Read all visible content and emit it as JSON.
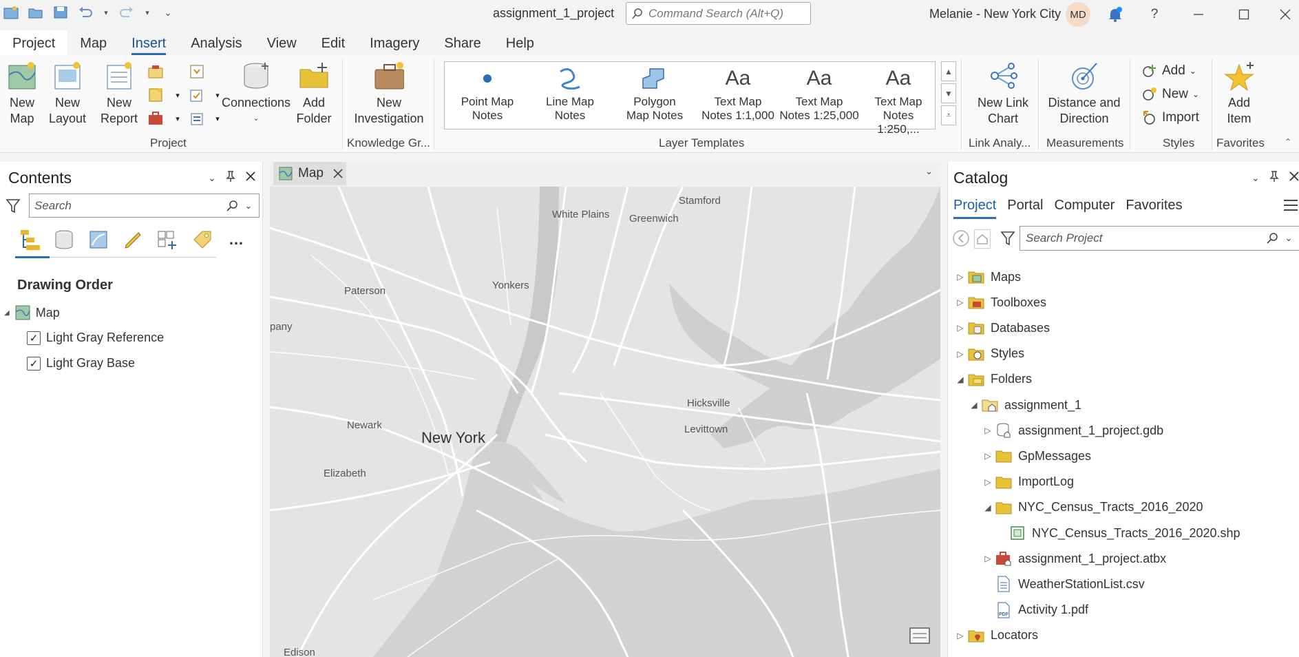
{
  "window": {
    "title": "assignment_1_project",
    "command_search_placeholder": "Command Search (Alt+Q)",
    "user": "Melanie - New York City",
    "avatar_initials": "MD"
  },
  "menu": {
    "tabs": [
      "Project",
      "Map",
      "Insert",
      "Analysis",
      "View",
      "Edit",
      "Imagery",
      "Share",
      "Help"
    ],
    "active": "Insert"
  },
  "ribbon": {
    "project_group": {
      "label": "Project",
      "new_map": "New Map",
      "new_layout": "New Layout",
      "new_report": "New Report",
      "connections": "Connections",
      "add_folder": "Add Folder"
    },
    "knowledge_group": {
      "label": "Knowledge Gr...",
      "new_investigation": "New Investigation"
    },
    "layer_templates": {
      "label": "Layer Templates",
      "items": [
        {
          "line1": "Point Map",
          "line2": "Notes"
        },
        {
          "line1": "Line Map",
          "line2": "Notes"
        },
        {
          "line1": "Polygon",
          "line2": "Map Notes"
        },
        {
          "line1": "Text Map",
          "line2": "Notes 1:1,000"
        },
        {
          "line1": "Text Map",
          "line2": "Notes 1:25,000"
        },
        {
          "line1": "Text Map",
          "line2": "Notes 1:250,..."
        }
      ]
    },
    "link_group": {
      "label": "Link Analy...",
      "button": "New Link Chart"
    },
    "measurements_group": {
      "label": "Measurements",
      "button": "Distance and Direction"
    },
    "styles_group": {
      "label": "Styles",
      "add": "Add",
      "new": "New",
      "import": "Import"
    },
    "favorites_group": {
      "label": "Favorites",
      "add_item": "Add Item"
    }
  },
  "contents": {
    "title": "Contents",
    "search_placeholder": "Search",
    "section": "Drawing Order",
    "map_name": "Map",
    "layers": [
      {
        "name": "Light Gray Reference",
        "checked": true
      },
      {
        "name": "Light Gray Base",
        "checked": true
      }
    ]
  },
  "map_view": {
    "tab": "Map",
    "labels": {
      "stamford": "Stamford",
      "white_plains": "White Plains",
      "greenwich": "Greenwich",
      "yonkers": "Yonkers",
      "paterson": "Paterson",
      "company": "pany",
      "hicksville": "Hicksville",
      "levittown": "Levittown",
      "newark": "Newark",
      "new_york": "New York",
      "elizabeth": "Elizabeth",
      "edison": "Edison"
    }
  },
  "catalog": {
    "title": "Catalog",
    "tabs": [
      "Project",
      "Portal",
      "Computer",
      "Favorites"
    ],
    "active_tab": "Project",
    "search_placeholder": "Search Project",
    "items": [
      {
        "label": "Maps",
        "depth": 0,
        "expander": "right",
        "icon": "maps-folder-icon"
      },
      {
        "label": "Toolboxes",
        "depth": 0,
        "expander": "right",
        "icon": "toolbox-folder-icon"
      },
      {
        "label": "Databases",
        "depth": 0,
        "expander": "right",
        "icon": "database-folder-icon"
      },
      {
        "label": "Styles",
        "depth": 0,
        "expander": "right",
        "icon": "styles-folder-icon"
      },
      {
        "label": "Folders",
        "depth": 0,
        "expander": "down",
        "icon": "folders-icon"
      },
      {
        "label": "assignment_1",
        "depth": 1,
        "expander": "down",
        "icon": "home-folder-icon"
      },
      {
        "label": "assignment_1_project.gdb",
        "depth": 2,
        "expander": "right",
        "icon": "geodatabase-icon"
      },
      {
        "label": "GpMessages",
        "depth": 2,
        "expander": "right",
        "icon": "folder-icon"
      },
      {
        "label": "ImportLog",
        "depth": 2,
        "expander": "right",
        "icon": "folder-icon"
      },
      {
        "label": "NYC_Census_Tracts_2016_2020",
        "depth": 2,
        "expander": "down",
        "icon": "folder-icon"
      },
      {
        "label": "NYC_Census_Tracts_2016_2020.shp",
        "depth": 3,
        "expander": "none",
        "icon": "shapefile-icon"
      },
      {
        "label": "assignment_1_project.atbx",
        "depth": 2,
        "expander": "right",
        "icon": "toolbox-icon"
      },
      {
        "label": "WeatherStationList.csv",
        "depth": 2,
        "expander": "none",
        "icon": "csv-file-icon"
      },
      {
        "label": "Activity 1.pdf",
        "depth": 2,
        "expander": "none",
        "icon": "pdf-file-icon"
      },
      {
        "label": "Locators",
        "depth": 0,
        "expander": "right",
        "icon": "locators-folder-icon"
      }
    ]
  },
  "colors": {
    "accent": "#2a6db7",
    "folder": "#e8c33a",
    "map_bg": "#e4e4e4",
    "water": "#cfcfcf",
    "roads": "#ffffff"
  }
}
